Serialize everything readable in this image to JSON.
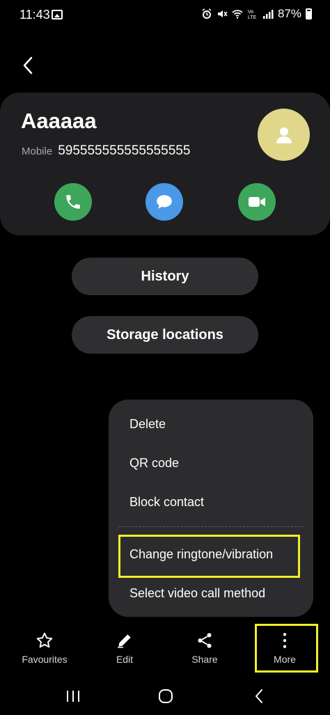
{
  "status_bar": {
    "time": "11:43",
    "battery": "87%",
    "icons": [
      "gallery-icon",
      "alarm-icon",
      "mute-icon",
      "wifi-icon",
      "volte-icon",
      "signal-icon",
      "battery-icon"
    ]
  },
  "contact": {
    "name": "Aaaaaa",
    "phone_label": "Mobile",
    "phone_number": "595555555555555555",
    "avatar_color": "#e0d78a"
  },
  "actions": {
    "call_color": "#3ea65b",
    "message_color": "#4a98e8",
    "video_color": "#3ea65b"
  },
  "buttons": {
    "history": "History",
    "storage": "Storage locations"
  },
  "menu": {
    "items": [
      {
        "label": "Delete"
      },
      {
        "label": "QR code"
      },
      {
        "label": "Block contact"
      },
      {
        "label": "Change ringtone/vibration"
      },
      {
        "label": "Select video call method"
      }
    ],
    "highlight_color": "#f2ee2a"
  },
  "toolbar": {
    "favourites": "Favourites",
    "edit": "Edit",
    "share": "Share",
    "more": "More"
  }
}
